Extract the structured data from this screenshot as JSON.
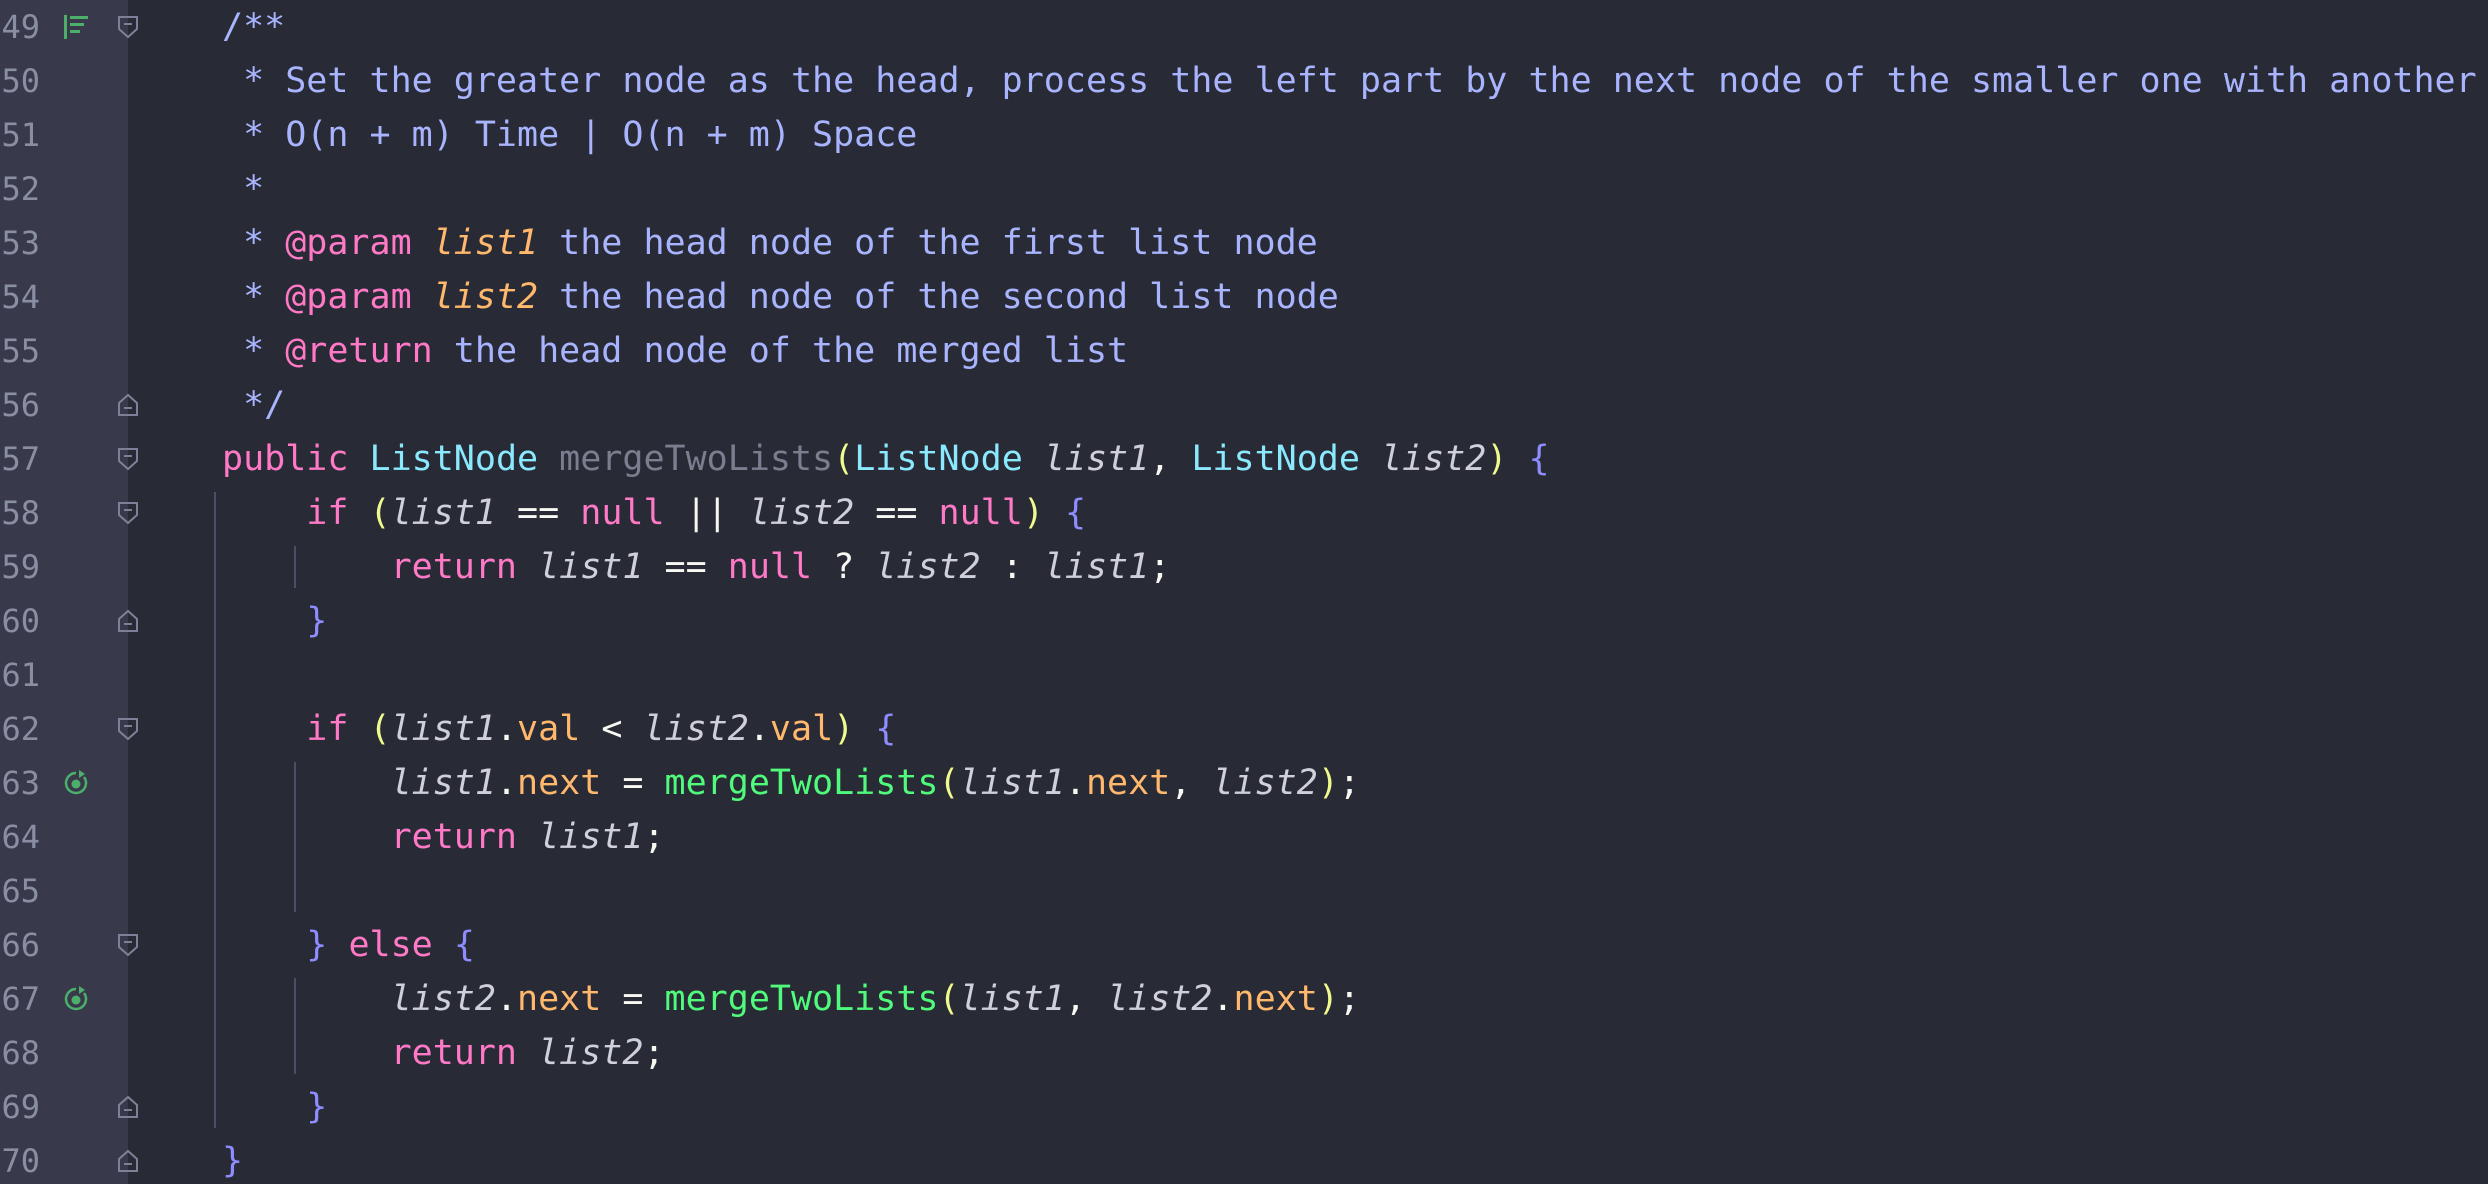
{
  "lines": [
    {
      "n": "49",
      "fold": "start",
      "gutter_icon": "implements-icon",
      "tokens": [
        [
          "c-com",
          "/**"
        ]
      ]
    },
    {
      "n": "50",
      "fold": "",
      "gutter_icon": "",
      "tokens": [
        [
          "c-com",
          " * Set the greater node as the head, process the left part by the next node of the smaller one with another node."
        ]
      ]
    },
    {
      "n": "51",
      "fold": "",
      "gutter_icon": "",
      "tokens": [
        [
          "c-com",
          " * O(n + m) Time | O(n + m) Space"
        ]
      ]
    },
    {
      "n": "52",
      "fold": "",
      "gutter_icon": "",
      "tokens": [
        [
          "c-com",
          " *"
        ]
      ]
    },
    {
      "n": "53",
      "fold": "",
      "gutter_icon": "",
      "tokens": [
        [
          "c-com",
          " * "
        ],
        [
          "c-tag",
          "@param"
        ],
        [
          "c-com",
          " "
        ],
        [
          "c-parname",
          "list1"
        ],
        [
          "c-com",
          " the head node of the first list node"
        ]
      ]
    },
    {
      "n": "54",
      "fold": "",
      "gutter_icon": "",
      "tokens": [
        [
          "c-com",
          " * "
        ],
        [
          "c-tag",
          "@param"
        ],
        [
          "c-com",
          " "
        ],
        [
          "c-parname",
          "list2"
        ],
        [
          "c-com",
          " the head node of the second list node"
        ]
      ]
    },
    {
      "n": "55",
      "fold": "",
      "gutter_icon": "",
      "tokens": [
        [
          "c-com",
          " * "
        ],
        [
          "c-tag",
          "@return"
        ],
        [
          "c-com",
          " the head node of the merged list"
        ]
      ]
    },
    {
      "n": "56",
      "fold": "end",
      "gutter_icon": "",
      "tokens": [
        [
          "c-com",
          " */"
        ]
      ]
    },
    {
      "n": "57",
      "fold": "start",
      "gutter_icon": "",
      "tokens": [
        [
          "c-kw",
          "public"
        ],
        [
          "c-op",
          " "
        ],
        [
          "c-type",
          "ListNode"
        ],
        [
          "c-op",
          " "
        ],
        [
          "c-method-def",
          "mergeTwoLists"
        ],
        [
          "c-p1",
          "("
        ],
        [
          "c-type",
          "ListNode"
        ],
        [
          "c-op",
          " "
        ],
        [
          "c-var",
          "list1"
        ],
        [
          "c-op",
          ", "
        ],
        [
          "c-type",
          "ListNode"
        ],
        [
          "c-op",
          " "
        ],
        [
          "c-var",
          "list2"
        ],
        [
          "c-p1",
          ")"
        ],
        [
          "c-op",
          " "
        ],
        [
          "c-p2",
          "{"
        ]
      ]
    },
    {
      "n": "58",
      "fold": "start",
      "gutter_icon": "",
      "tokens": [
        [
          "c-op",
          "    "
        ],
        [
          "c-kw",
          "if"
        ],
        [
          "c-op",
          " "
        ],
        [
          "c-p1",
          "("
        ],
        [
          "c-var",
          "list1"
        ],
        [
          "c-op",
          " == "
        ],
        [
          "c-kw",
          "null"
        ],
        [
          "c-op",
          " || "
        ],
        [
          "c-var",
          "list2"
        ],
        [
          "c-op",
          " == "
        ],
        [
          "c-kw",
          "null"
        ],
        [
          "c-p1",
          ")"
        ],
        [
          "c-op",
          " "
        ],
        [
          "c-p2",
          "{"
        ]
      ]
    },
    {
      "n": "59",
      "fold": "",
      "gutter_icon": "",
      "tokens": [
        [
          "c-op",
          "        "
        ],
        [
          "c-kw",
          "return"
        ],
        [
          "c-op",
          " "
        ],
        [
          "c-var",
          "list1"
        ],
        [
          "c-op",
          " == "
        ],
        [
          "c-kw",
          "null"
        ],
        [
          "c-op",
          " ? "
        ],
        [
          "c-var",
          "list2"
        ],
        [
          "c-op",
          " : "
        ],
        [
          "c-var",
          "list1"
        ],
        [
          "c-op",
          ";"
        ]
      ]
    },
    {
      "n": "60",
      "fold": "end",
      "gutter_icon": "",
      "tokens": [
        [
          "c-op",
          "    "
        ],
        [
          "c-p2",
          "}"
        ]
      ]
    },
    {
      "n": "61",
      "fold": "",
      "gutter_icon": "",
      "tokens": []
    },
    {
      "n": "62",
      "fold": "start",
      "gutter_icon": "",
      "tokens": [
        [
          "c-op",
          "    "
        ],
        [
          "c-kw",
          "if"
        ],
        [
          "c-op",
          " "
        ],
        [
          "c-p1",
          "("
        ],
        [
          "c-var",
          "list1"
        ],
        [
          "c-op",
          "."
        ],
        [
          "c-field",
          "val"
        ],
        [
          "c-op",
          " < "
        ],
        [
          "c-var",
          "list2"
        ],
        [
          "c-op",
          "."
        ],
        [
          "c-field",
          "val"
        ],
        [
          "c-p1",
          ")"
        ],
        [
          "c-op",
          " "
        ],
        [
          "c-p2",
          "{"
        ]
      ]
    },
    {
      "n": "63",
      "fold": "",
      "gutter_icon": "recursive-call-icon",
      "tokens": [
        [
          "c-op",
          "        "
        ],
        [
          "c-var",
          "list1"
        ],
        [
          "c-op",
          "."
        ],
        [
          "c-field",
          "next"
        ],
        [
          "c-op",
          " = "
        ],
        [
          "c-call",
          "mergeTwoLists"
        ],
        [
          "c-p1",
          "("
        ],
        [
          "c-var",
          "list1"
        ],
        [
          "c-op",
          "."
        ],
        [
          "c-field",
          "next"
        ],
        [
          "c-op",
          ", "
        ],
        [
          "c-var",
          "list2"
        ],
        [
          "c-p1",
          ")"
        ],
        [
          "c-op",
          ";"
        ]
      ]
    },
    {
      "n": "64",
      "fold": "",
      "gutter_icon": "",
      "tokens": [
        [
          "c-op",
          "        "
        ],
        [
          "c-kw",
          "return"
        ],
        [
          "c-op",
          " "
        ],
        [
          "c-var",
          "list1"
        ],
        [
          "c-op",
          ";"
        ]
      ]
    },
    {
      "n": "65",
      "fold": "",
      "gutter_icon": "",
      "tokens": []
    },
    {
      "n": "66",
      "fold": "start",
      "gutter_icon": "",
      "tokens": [
        [
          "c-op",
          "    "
        ],
        [
          "c-p2",
          "}"
        ],
        [
          "c-op",
          " "
        ],
        [
          "c-kw",
          "else"
        ],
        [
          "c-op",
          " "
        ],
        [
          "c-p2",
          "{"
        ]
      ]
    },
    {
      "n": "67",
      "fold": "",
      "gutter_icon": "recursive-call-icon",
      "tokens": [
        [
          "c-op",
          "        "
        ],
        [
          "c-var",
          "list2"
        ],
        [
          "c-op",
          "."
        ],
        [
          "c-field",
          "next"
        ],
        [
          "c-op",
          " = "
        ],
        [
          "c-call",
          "mergeTwoLists"
        ],
        [
          "c-p1",
          "("
        ],
        [
          "c-var",
          "list1"
        ],
        [
          "c-op",
          ", "
        ],
        [
          "c-var",
          "list2"
        ],
        [
          "c-op",
          "."
        ],
        [
          "c-field",
          "next"
        ],
        [
          "c-p1",
          ")"
        ],
        [
          "c-op",
          ";"
        ]
      ]
    },
    {
      "n": "68",
      "fold": "",
      "gutter_icon": "",
      "tokens": [
        [
          "c-op",
          "        "
        ],
        [
          "c-kw",
          "return"
        ],
        [
          "c-op",
          " "
        ],
        [
          "c-var",
          "list2"
        ],
        [
          "c-op",
          ";"
        ]
      ]
    },
    {
      "n": "69",
      "fold": "end",
      "gutter_icon": "",
      "tokens": [
        [
          "c-op",
          "    "
        ],
        [
          "c-p2",
          "}"
        ]
      ]
    },
    {
      "n": "70",
      "fold": "end",
      "gutter_icon": "",
      "tokens": [
        [
          "c-p2",
          "}"
        ]
      ]
    }
  ],
  "colors": {
    "background": "#282a36",
    "gutter": "#383a4b",
    "comment": "#a9b4ff",
    "keyword": "#ff79c6",
    "type": "#8be9fd",
    "method_call": "#50fa7b",
    "field": "#ffb86c",
    "paren": "#f1fa8c",
    "brace": "#8e8dff",
    "gutter_icon": "#4caf6a"
  }
}
